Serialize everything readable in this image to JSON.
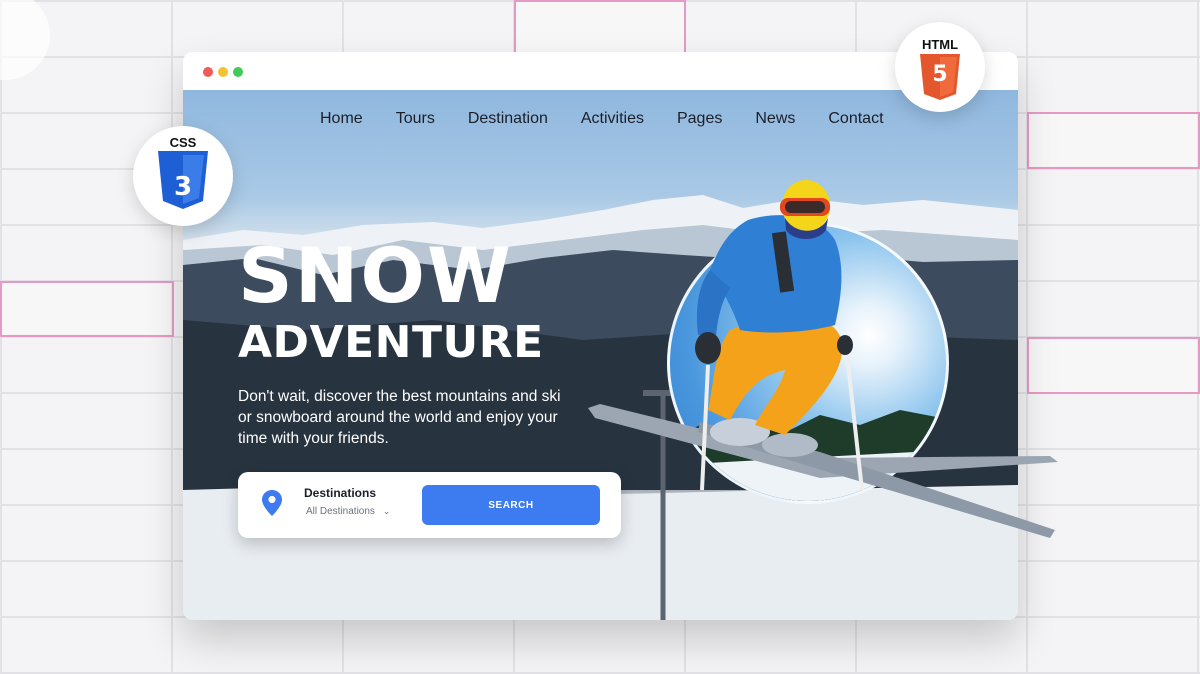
{
  "nav": {
    "items": [
      {
        "label": "Home"
      },
      {
        "label": "Tours"
      },
      {
        "label": "Destination"
      },
      {
        "label": "Activities"
      },
      {
        "label": "Pages"
      },
      {
        "label": "News"
      },
      {
        "label": "Contact"
      }
    ]
  },
  "hero": {
    "title_line1": "SNOW",
    "title_line2": "ADVENTURE",
    "subtitle": "Don't wait, discover the best mountains and ski or snowboard around the world and enjoy your time with your friends."
  },
  "search": {
    "destinations_label": "Destinations",
    "destinations_value": "All Destinations",
    "button_label": "SEARCH"
  },
  "badges": {
    "css_label": "CSS",
    "css_number": "3",
    "html_label": "HTML",
    "html_number": "5"
  },
  "colors": {
    "accent": "#3d7bf0",
    "css_blue": "#1f5fd6",
    "html_orange": "#e4572e",
    "jacket": "#2f7fd4",
    "pants": "#f5a21b",
    "helmet": "#f4d51a"
  },
  "icons": [
    "location-pin-icon",
    "chevron-down-icon",
    "css3-shield-icon",
    "html5-shield-icon"
  ]
}
